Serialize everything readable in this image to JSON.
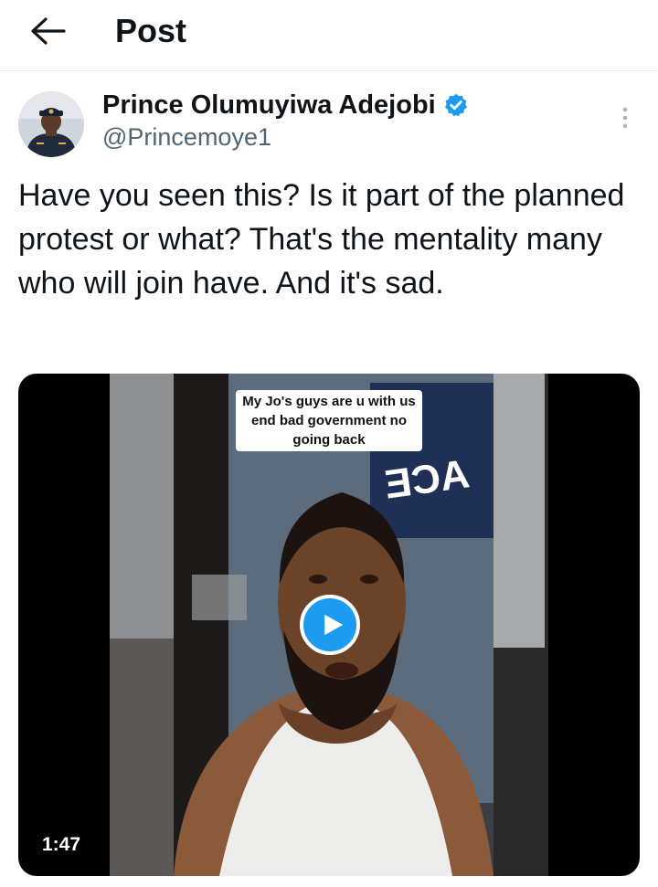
{
  "header": {
    "title": "Post",
    "back_icon": "arrow-left-icon"
  },
  "author": {
    "display_name": "Prince Olumuyiwa Adejobi",
    "handle": "@Princemoye1",
    "verified": true,
    "verified_color": "#1d9bf0",
    "avatar_icon": "profile-photo"
  },
  "tweet": {
    "text": "Have you seen this? Is it part of the planned protest or what? That's the mentality many who will join have. And it's sad."
  },
  "media": {
    "type": "video",
    "caption": "My Jo's guys are u with us end bad government no going back",
    "duration": "1:47",
    "play_icon": "play-icon",
    "play_color": "#1d9bf0"
  },
  "colors": {
    "text": "#0f1419",
    "secondary": "#536471",
    "accent": "#1d9bf0",
    "divider": "#e6e9ec"
  }
}
